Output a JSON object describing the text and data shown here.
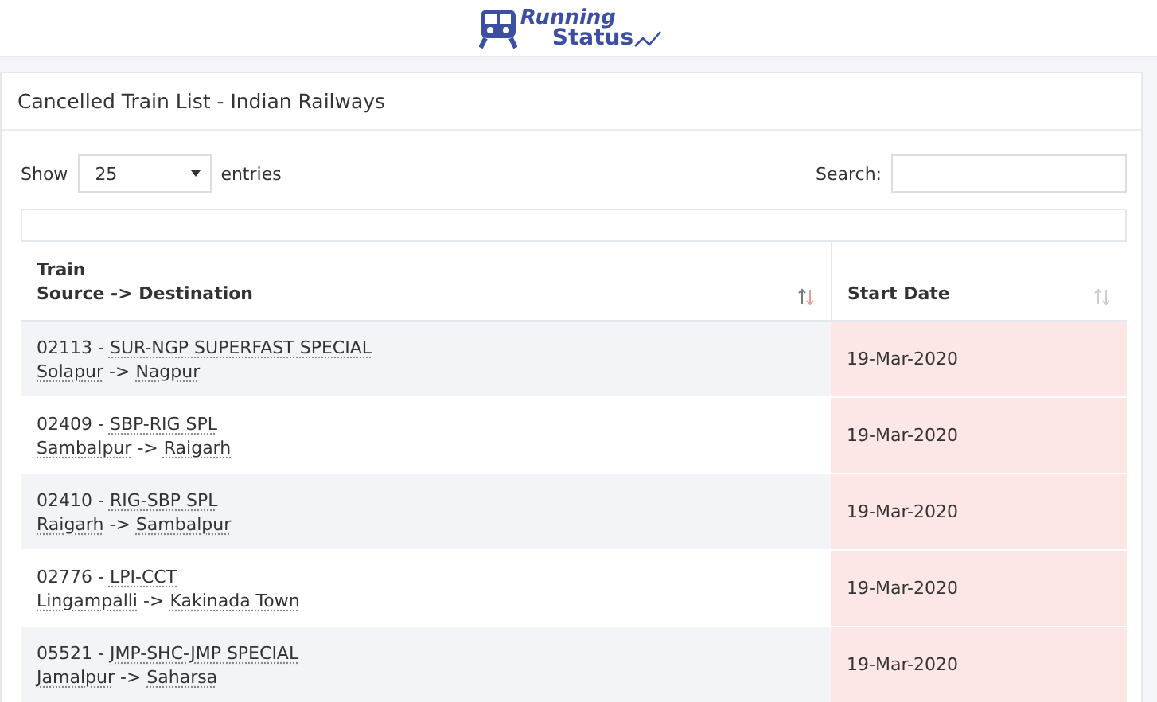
{
  "logo": {
    "line1": "Running",
    "line2": "Status"
  },
  "card": {
    "title": "Cancelled Train List - Indian Railways"
  },
  "length_menu": {
    "before": "Show",
    "value": "25",
    "after": "entries"
  },
  "search": {
    "label": "Search:"
  },
  "table": {
    "columns": [
      {
        "lines": [
          "Train",
          "Source -> Destination"
        ],
        "kind": "train"
      },
      {
        "lines": [
          "Start Date"
        ],
        "kind": "date"
      }
    ],
    "rows": [
      {
        "prefix": "02113 -",
        "name": "SUR-NGP SUPERFAST SPECIAL",
        "source": "Solapur",
        "arrow": "->",
        "destination": "Nagpur",
        "start_date": "19-Mar-2020",
        "cancelled": true
      },
      {
        "prefix": "02409 -",
        "name": "SBP-RIG SPL",
        "source": "Sambalpur",
        "arrow": "->",
        "destination": "Raigarh",
        "start_date": "19-Mar-2020",
        "cancelled": true
      },
      {
        "prefix": "02410 -",
        "name": "RIG-SBP SPL",
        "source": "Raigarh",
        "arrow": "->",
        "destination": "Sambalpur",
        "start_date": "19-Mar-2020",
        "cancelled": true
      },
      {
        "prefix": "02776 -",
        "name": "LPI-CCT",
        "source": "Lingampalli",
        "arrow": "->",
        "destination": "Kakinada Town",
        "start_date": "19-Mar-2020",
        "cancelled": true
      },
      {
        "prefix": "05521 -",
        "name": "JMP-SHC-JMP SPECIAL",
        "source": "Jamalpur",
        "arrow": "->",
        "destination": "Saharsa",
        "start_date": "19-Mar-2020",
        "cancelled": true
      }
    ]
  }
}
